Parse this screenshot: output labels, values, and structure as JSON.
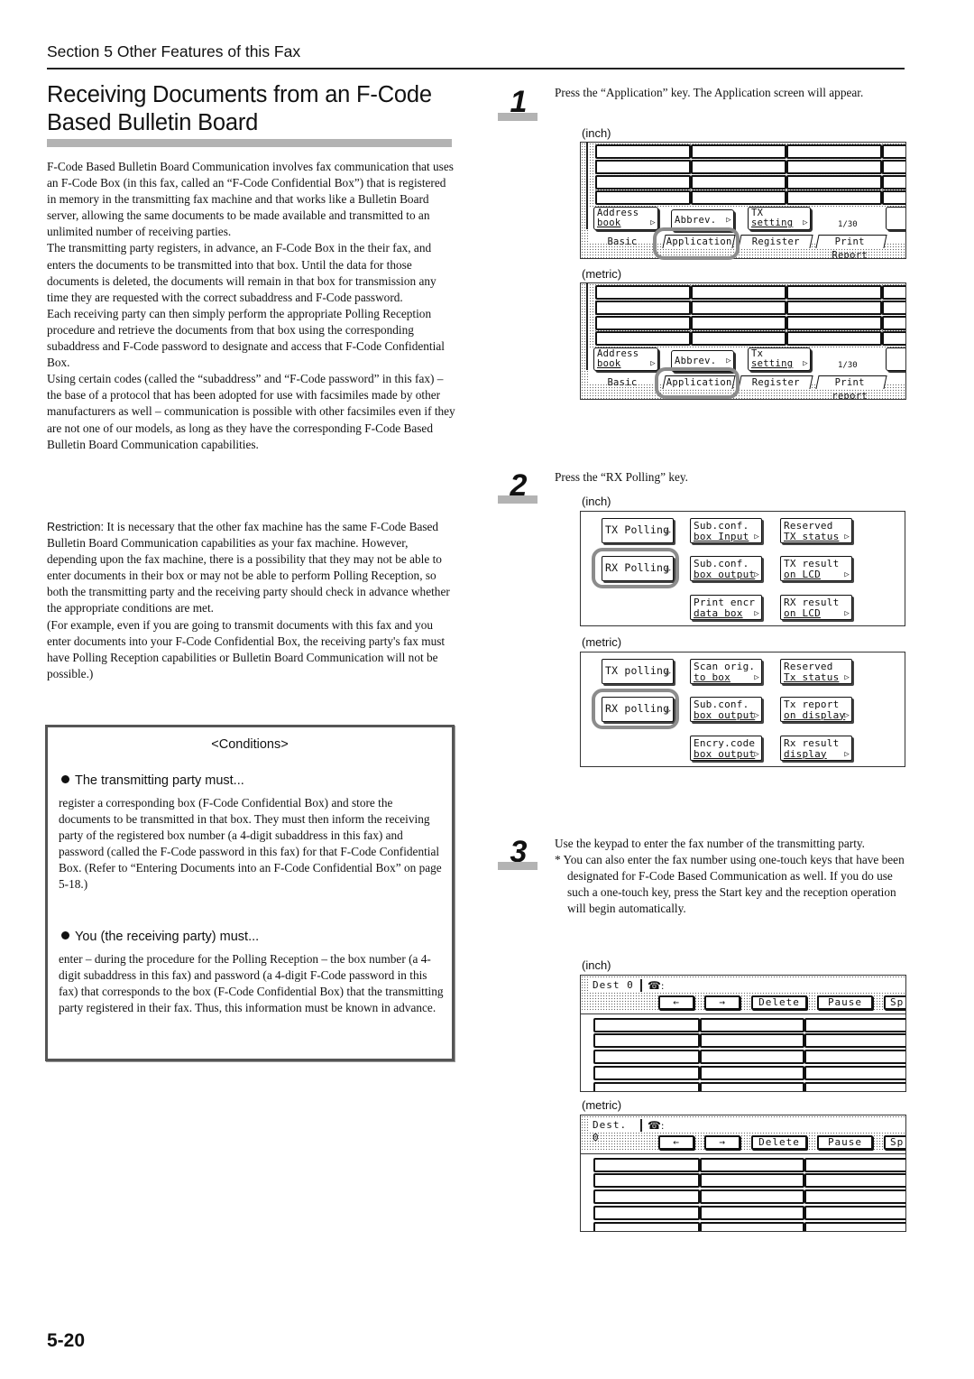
{
  "header": {
    "section": "Section 5  Other Features of this Fax"
  },
  "title": {
    "line1": "Receiving Documents from an F-Code",
    "line2": "Based Bulletin Board"
  },
  "intro": {
    "p1": "F-Code Based Bulletin Board Communication involves fax communication that uses an F-Code Box (in this fax, called an “F-Code Confidential Box”) that is registered in memory in the transmitting fax machine and that works like a Bulletin Board server, allowing the same documents to be made available and transmitted to an unlimited number of receiving parties.",
    "p2": "The transmitting party registers, in advance, an F-Code Box in the their fax, and enters the documents to be transmitted into that box. Until the data for those documents is deleted, the documents will remain in that box for transmission any time they are requested with the correct subaddress and F-Code password.",
    "p3": "Each receiving party can then simply perform the appropriate Polling Reception procedure and retrieve the documents from that box using the corresponding subaddress and F-Code password to designate and access that F-Code Confidential Box.",
    "p4": "Using certain codes (called the “subaddress” and “F-Code password” in this fax) – the base of a protocol that has been adopted for use with facsimiles made by other manufacturers as well – communication is possible with other facsimiles even if they are not one of our models, as long as they have the corresponding F-Code Based Bulletin Board Communication capabilities."
  },
  "restriction": {
    "label": "Restriction:",
    "text": " It is necessary that the other fax machine has the same F-Code Based Bulletin Board Communication capabilities as your fax machine. However, depending upon the fax machine, there is a possibility that they may not be able to enter documents in their box or may not be able to perform Polling Reception, so both the transmitting party and the receiving party should check in advance whether the appropriate conditions are met.",
    "example": "(For example, even if you are going to transmit documents with this fax and you enter documents into your F-Code Confidential Box, the receiving party's fax must have Polling Reception capabilities or Bulletin Board Communication will not be possible.)"
  },
  "conditions": {
    "title": "<Conditions>",
    "transmitting_head": "The transmitting party must...",
    "transmitting_body": "register a corresponding box (F-Code Confidential Box) and store the documents to be transmitted in that box. They must then inform the receiving party of the registered box number (a 4-digit subaddress in this fax) and password (called the F-Code password in this fax) for that F-Code Confidential Box. (Refer to “Entering Documents into an F-Code Confidential Box” on page 5-18.)",
    "receiving_head": "You (the receiving party) must...",
    "receiving_body": "enter – during the procedure for the Polling Reception – the box number (a 4-digit subaddress in this fax) and password (a 4-digit F-Code password in this fax) that corresponds to the box (F-Code Confidential Box) that the transmitting party registered in their fax. Thus, this information must be known in advance."
  },
  "steps": [
    {
      "number": "1",
      "text": "Press the “Application” key. The Application screen will appear.",
      "screens": [
        {
          "unit": "(inch)",
          "buttons": [
            {
              "line1": "Address",
              "line2": "book"
            },
            {
              "line1": "Abbrev.",
              "line2": ""
            },
            {
              "line1": "TX",
              "line2": "setting"
            }
          ],
          "page_counter": "1/30",
          "tabs": [
            "Basic",
            "Application",
            "Register",
            "Print Report"
          ],
          "highlighted": "Application"
        },
        {
          "unit": "(metric)",
          "buttons": [
            {
              "line1": "Address",
              "line2": "book"
            },
            {
              "line1": "Abbrev.",
              "line2": ""
            },
            {
              "line1": "Tx",
              "line2": "setting"
            }
          ],
          "page_counter": "1/30",
          "tabs": [
            "Basic",
            "Application",
            "Register",
            "Print report"
          ],
          "highlighted": "Application"
        }
      ]
    },
    {
      "number": "2",
      "text": "Press the “RX Polling” key.",
      "screens": [
        {
          "unit": "(inch)",
          "buttons": [
            {
              "line1": "TX Polling",
              "line2": ""
            },
            {
              "line1": "Sub.conf.",
              "line2": "box Input"
            },
            {
              "line1": "Reserved",
              "line2": "TX status"
            },
            {
              "line1": "RX Polling",
              "line2": ""
            },
            {
              "line1": "Sub.conf.",
              "line2": "box output"
            },
            {
              "line1": "TX result",
              "line2": "on LCD"
            },
            {
              "line1": "Print encr",
              "line2": "data box"
            },
            {
              "line1": "RX result",
              "line2": "on LCD"
            }
          ],
          "highlighted": "RX Polling"
        },
        {
          "unit": "(metric)",
          "buttons": [
            {
              "line1": "TX polling",
              "line2": ""
            },
            {
              "line1": "Scan orig.",
              "line2": "to box"
            },
            {
              "line1": "Reserved",
              "line2": "Tx status"
            },
            {
              "line1": "RX polling",
              "line2": ""
            },
            {
              "line1": "Sub.conf.",
              "line2": "box output"
            },
            {
              "line1": "Tx report",
              "line2": "on display"
            },
            {
              "line1": "Encry.code",
              "line2": "box output"
            },
            {
              "line1": "Rx result",
              "line2": "display"
            }
          ],
          "highlighted": "RX polling"
        }
      ]
    },
    {
      "number": "3",
      "text": "Use the keypad to enter the fax number of the transmitting party.",
      "note": "* You can also enter the fax number using one-touch keys that have been designated for F-Code Based Communication as well. If you do use such a one-touch key, press the Start key and the reception operation will begin automatically.",
      "screens": [
        {
          "unit": "(inch)",
          "dest_label": "Dest 0",
          "phone_icon": "☎",
          "phone_suffix": ":",
          "keys": [
            "←",
            "→",
            "Delete",
            "Pause",
            "Sp"
          ]
        },
        {
          "unit": "(metric)",
          "dest_label": "Dest. 0",
          "phone_icon": "☎",
          "phone_suffix": ":",
          "keys": [
            "←",
            "→",
            "Delete",
            "Pause",
            "Sp"
          ]
        }
      ]
    }
  ],
  "footer": {
    "page_number": "5-20"
  }
}
